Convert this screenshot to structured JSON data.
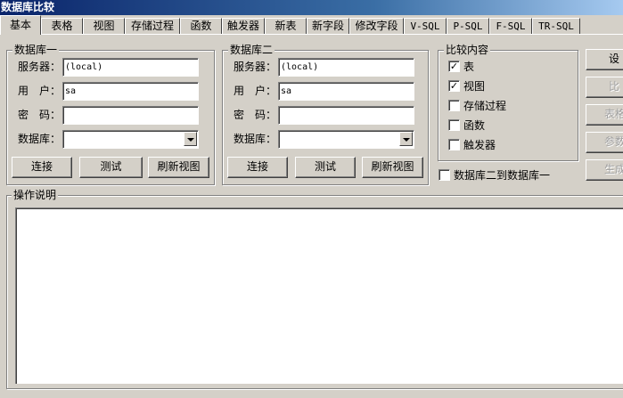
{
  "window": {
    "title": "数据库比较"
  },
  "tabs": [
    {
      "label": "基本",
      "active": true
    },
    {
      "label": "表格"
    },
    {
      "label": "视图"
    },
    {
      "label": "存储过程"
    },
    {
      "label": "函数"
    },
    {
      "label": "触发器"
    },
    {
      "label": "新表"
    },
    {
      "label": "新字段"
    },
    {
      "label": "修改字段"
    },
    {
      "label": "V-SQL"
    },
    {
      "label": "P-SQL"
    },
    {
      "label": "F-SQL"
    },
    {
      "label": "TR-SQL"
    }
  ],
  "db1": {
    "title": "数据库一",
    "server_label": "服务器：",
    "server_value": "(local)",
    "user_label": "用　户：",
    "user_value": "sa",
    "password_label": "密　码：",
    "password_value": "",
    "database_label": "数据库：",
    "database_value": "",
    "connect": "连接",
    "test": "测试",
    "refresh": "刷新视图"
  },
  "db2": {
    "title": "数据库二",
    "server_label": "服务器：",
    "server_value": "(local)",
    "user_label": "用　户：",
    "user_value": "sa",
    "password_label": "密　码：",
    "password_value": "",
    "database_label": "数据库：",
    "database_value": "",
    "connect": "连接",
    "test": "测试",
    "refresh": "刷新视图"
  },
  "compare": {
    "title": "比较内容",
    "items": [
      {
        "label": "表",
        "checked": true
      },
      {
        "label": "视图",
        "checked": true
      },
      {
        "label": "存储过程",
        "checked": false
      },
      {
        "label": "函数",
        "checked": false
      },
      {
        "label": "触发器",
        "checked": false
      }
    ],
    "direction_label": "数据库二到数据库一",
    "direction_checked": false
  },
  "side_buttons": [
    {
      "label": "设",
      "enabled": true
    },
    {
      "label": "比",
      "enabled": false
    },
    {
      "label": "表格",
      "enabled": false
    },
    {
      "label": "参数",
      "enabled": false
    },
    {
      "label": "生成",
      "enabled": false
    }
  ],
  "instructions": {
    "title": "操作说明",
    "text": ""
  },
  "colors": {
    "titlebar_start": "#0a246a",
    "face": "#d4d0c8"
  }
}
